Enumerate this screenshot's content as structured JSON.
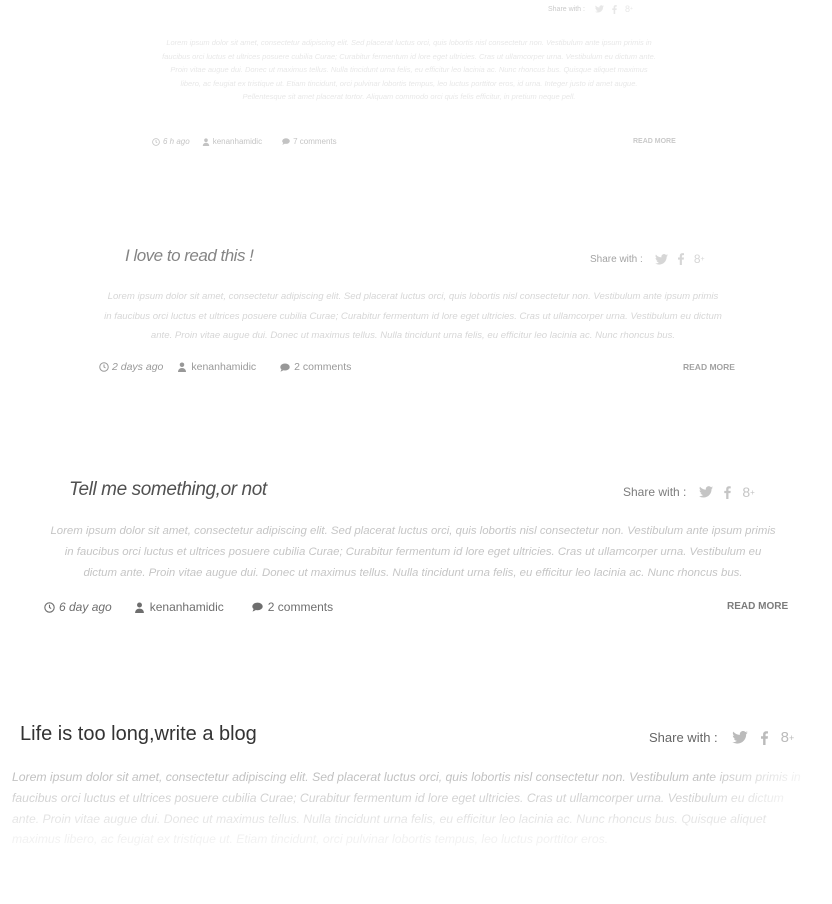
{
  "posts": [
    {
      "title": "",
      "share_label": "Share with :",
      "body": "Lorem ipsum dolor sit amet, consectetur adipiscing elit. Sed placerat luctus orci, quis lobortis nisl consectetur non. Vestibulum ante ipsum primis in faucibus orci luctus et ultrices posuere cubilia Curae; Curabitur fermentum id lore eget ultricies. Cras ut ullamcorper urna. Vestibulum eu dictum ante. Proin vitae augue dui. Donec ut maximus tellus. Nulla tincidunt urna felis, eu efficitur leo lacinia ac. Nunc rhoncus bus. Quisque aliquet maximus libero, ac feugiat ex tristique ut. Etiam tincidunt, orci pulvinar lobortis tempus, leo luctus porttitor eros, id urna. Integer justo id amet augue. Pellentesque sit amet placerat tortor. Aliquam commodo orci quis felis efficitur, in pretium neque pell.",
      "time": "6 h ago",
      "author": "kenanhamidic",
      "comments": "7 comments",
      "read_more": "READ MORE"
    },
    {
      "title": "I love to read this !",
      "share_label": "Share with :",
      "body": "Lorem ipsum dolor sit amet, consectetur adipiscing elit. Sed placerat luctus orci, quis lobortis nisl consectetur non. Vestibulum ante ipsum primis in faucibus orci luctus et ultrices posuere cubilia Curae; Curabitur fermentum id lore eget ultricies. Cras ut ullamcorper urna. Vestibulum eu dictum ante. Proin vitae augue dui. Donec ut maximus tellus. Nulla tincidunt urna felis, eu efficitur leo lacinia ac. Nunc rhoncus bus.",
      "time": "2 days ago",
      "author": "kenanhamidic",
      "comments": "2 comments",
      "read_more": "READ MORE"
    },
    {
      "title": "Tell me something,or not",
      "share_label": "Share with :",
      "body": "Lorem ipsum dolor sit amet, consectetur adipiscing elit. Sed placerat luctus orci, quis lobortis nisl consectetur non. Vestibulum ante ipsum primis in faucibus orci luctus et ultrices posuere cubilia Curae; Curabitur fermentum id lore eget ultricies. Cras ut ullamcorper urna. Vestibulum eu dictum ante. Proin vitae augue dui. Donec ut maximus tellus. Nulla tincidunt urna felis, eu efficitur leo lacinia ac. Nunc rhoncus bus.",
      "time": "6 day ago",
      "author": "kenanhamidic",
      "comments": "2 comments",
      "read_more": "READ MORE"
    },
    {
      "title": "Life is too long,write a blog",
      "share_label": "Share with :",
      "body": "Lorem ipsum dolor sit amet, consectetur adipiscing elit. Sed placerat luctus orci, quis lobortis nisl consectetur non. Vestibulum ante ipsum primis in faucibus orci luctus et ultrices posuere cubilia Curae; Curabitur fermentum id lore eget ultricies. Cras ut ullamcorper urna. Vestibulum eu dictum ante. Proin vitae augue dui. Donec ut maximus tellus. Nulla tincidunt urna felis, eu efficitur leo lacinia ac. Nunc rhoncus bus. Quisque aliquet maximus libero, ac feugiat ex tristique ut. Etiam tincidunt, orci pulvinar lobortis tempus, leo luctus porttitor eros.",
      "time": "",
      "author": "",
      "comments": "",
      "read_more": ""
    }
  ],
  "icons": [
    "twitter-icon",
    "facebook-icon",
    "google-plus-icon",
    "clock-icon",
    "user-icon",
    "comment-icon"
  ],
  "colors": {
    "title": "#333333",
    "text": "#bbbbbb",
    "meta": "#555555",
    "icon": "#bbbbbb"
  }
}
